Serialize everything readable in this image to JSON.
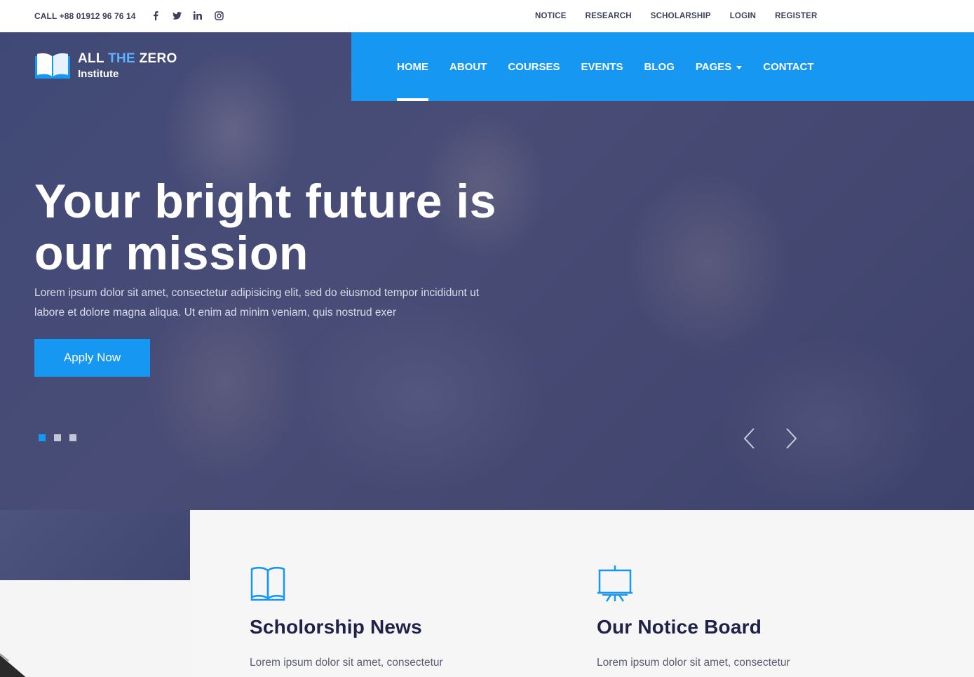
{
  "topbar": {
    "call": "CALL +88 01912 96 76 14",
    "socials": [
      "facebook-icon",
      "twitter-icon",
      "linkedin-icon",
      "instagram-icon"
    ],
    "links": [
      "NOTICE",
      "RESEARCH",
      "SCHOLARSHIP",
      "LOGIN",
      "REGISTER"
    ]
  },
  "logo": {
    "line1_a": "ALL",
    "line1_b": "THE",
    "line1_c": "ZERO",
    "line2": "Institute"
  },
  "nav": {
    "items": [
      "HOME",
      "ABOUT",
      "COURSES",
      "EVENTS",
      "BLOG",
      "PAGES",
      "CONTACT"
    ],
    "active": "HOME"
  },
  "hero": {
    "title_line1": "Your bright future is",
    "title_line2": "our mission",
    "text_line1": "Lorem ipsum dolor sit amet, consectetur adipisicing elit, sed do eiusmod tempor incididunt ut",
    "text_line2": "labore et dolore magna aliqua. Ut enim ad minim veniam, quis nostrud exer",
    "button": "Apply Now",
    "slides": 3,
    "active_slide": 1
  },
  "features": [
    {
      "icon": "book-open-icon",
      "title": "Scholorship News",
      "text": "Lorem ipsum dolor sit amet, consectetur"
    },
    {
      "icon": "presentation-board-icon",
      "title": "Our Notice Board",
      "text": "Lorem ipsum dolor sit amet, consectetur"
    }
  ],
  "colors": {
    "primary": "#1597f2",
    "heading": "#1f2149",
    "topbar_text": "#3b3f58"
  }
}
